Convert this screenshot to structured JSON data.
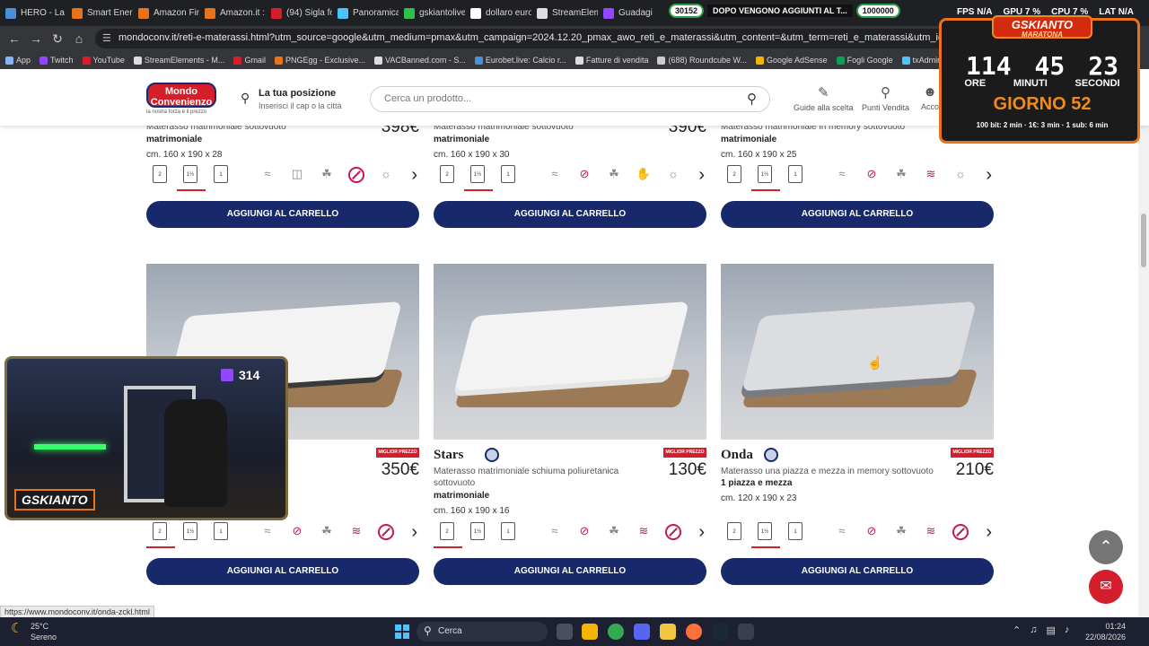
{
  "browser": {
    "tabs": [
      {
        "label": "HERO - La p",
        "color": "#4a90d9"
      },
      {
        "label": "Smart Energ",
        "color": "#e8731a"
      },
      {
        "label": "Amazon Fin",
        "color": "#e8731a"
      },
      {
        "label": "Amazon.it :",
        "color": "#e8731a"
      },
      {
        "label": "(94) Sigla fo",
        "color": "#d51e2b"
      },
      {
        "label": "Panoramica",
        "color": "#4cc2ff"
      },
      {
        "label": "gskiantolive",
        "color": "#2fbf4a"
      },
      {
        "label": "dollaro euro",
        "color": "#ffffff"
      },
      {
        "label": "StreamElem",
        "color": "#dddddd"
      },
      {
        "label": "Guadagi",
        "color": "#9146ff"
      }
    ],
    "url": "mondoconv.it/reti-e-materassi.html?utm_source=google&utm_medium=pmax&utm_campaign=2024.12.20_pmax_awo_reti_e_materassi&utm_content=&utm_term=reti_e_materassi&utm_id=22044948708&utm_group_id=65",
    "bookmarks": [
      {
        "label": "App",
        "color": "#8ab4f8"
      },
      {
        "label": "Twitch",
        "color": "#9146ff"
      },
      {
        "label": "YouTube",
        "color": "#d51e2b"
      },
      {
        "label": "StreamElements - M...",
        "color": "#dddddd"
      },
      {
        "label": "Gmail",
        "color": "#d51e2b"
      },
      {
        "label": "PNGEgg - Exclusive...",
        "color": "#e8731a"
      },
      {
        "label": "VACBanned.com - S...",
        "color": "#dddddd"
      },
      {
        "label": "Eurobet.live: Calcio r...",
        "color": "#4a90d9"
      },
      {
        "label": "Fatture di vendita",
        "color": "#dddddd"
      },
      {
        "label": "(688) Roundcube W...",
        "color": "#cccccc"
      },
      {
        "label": "Google AdSense",
        "color": "#f4b400"
      },
      {
        "label": "Fogli Google",
        "color": "#0f9d58"
      },
      {
        "label": "txAdmin",
        "color": "#4cc2ff"
      }
    ],
    "status_url": "https://www.mondoconv.it/onda-zckl.html"
  },
  "site": {
    "logo_text": "Mondo Convenienzo",
    "logo_tagline": "la nostra forza è il prezzo",
    "position_title": "La tua posizione",
    "position_sub": "Inserisci il cap o la città",
    "search_placeholder": "Cerca un prodotto...",
    "links": [
      {
        "label": "Guide alla scelta",
        "icon": "pencil-icon"
      },
      {
        "label": "Punti Vendita",
        "icon": "pin-icon"
      },
      {
        "label": "Acco",
        "icon": "user-icon"
      }
    ]
  },
  "products_top": [
    {
      "title": "Materasso matrimoniale sottovuoto",
      "bold": "matrimoniale",
      "size": "cm. 160 x 190 x 28",
      "price": "398€"
    },
    {
      "title": "Materasso matrimoniale sottovuoto",
      "bold": "matrimoniale",
      "size": "cm. 160 x 190 x 30",
      "price": "390€"
    },
    {
      "title": "Materasso matrimoniale in memory sottovuoto",
      "bold": "matrimoniale",
      "size": "cm. 160 x 190 x 25",
      "price": ""
    }
  ],
  "products_bottom": [
    {
      "name": "",
      "title": "o",
      "bold": "",
      "size": "",
      "price": "350€",
      "badge": "MIGLIOR PREZZO"
    },
    {
      "name": "Stars",
      "title": "Materasso matrimoniale schiuma poliuretanica sottovuoto",
      "bold": "matrimoniale",
      "size": "cm. 160 x 190 x 16",
      "price": "130€",
      "badge": "MIGLIOR PREZZO"
    },
    {
      "name": "Onda",
      "title": "Materasso una piazza e mezza in memory sottovuoto",
      "bold": "1 piazza e mezza",
      "size": "cm. 120 x 190 x 23",
      "price": "210€",
      "badge": "MIGLIOR PREZZO"
    }
  ],
  "dim_labels": [
    "2",
    "1½",
    "1"
  ],
  "cart_label": "AGGIUNGI AL CARRELLO",
  "overlay": {
    "count_left": "30152",
    "marquee": "DOPO VENGONO AGGIUNTI AL T...",
    "count_right": "1000000",
    "stats": [
      "FPS N/A",
      "GPU 7 %",
      "CPU 7 %",
      "LAT N/A"
    ],
    "timer_brand": "GSKIANTO",
    "timer_sub": "MARATONA",
    "hours": "114",
    "minutes": "45",
    "seconds": "23",
    "label_h": "ORE",
    "label_m": "MINUTI",
    "label_s": "SECONDI",
    "day": "GIORNO 52",
    "rules": "100 bit: 2 min · 1€: 3 min · 1 sub: 6 min",
    "viewers": "314",
    "cam_logo": "GSKIANTO"
  },
  "taskbar": {
    "temp": "25°C",
    "weather": "Sereno",
    "search": "Cerca",
    "time": "01:24",
    "date": "22/08/2026"
  }
}
